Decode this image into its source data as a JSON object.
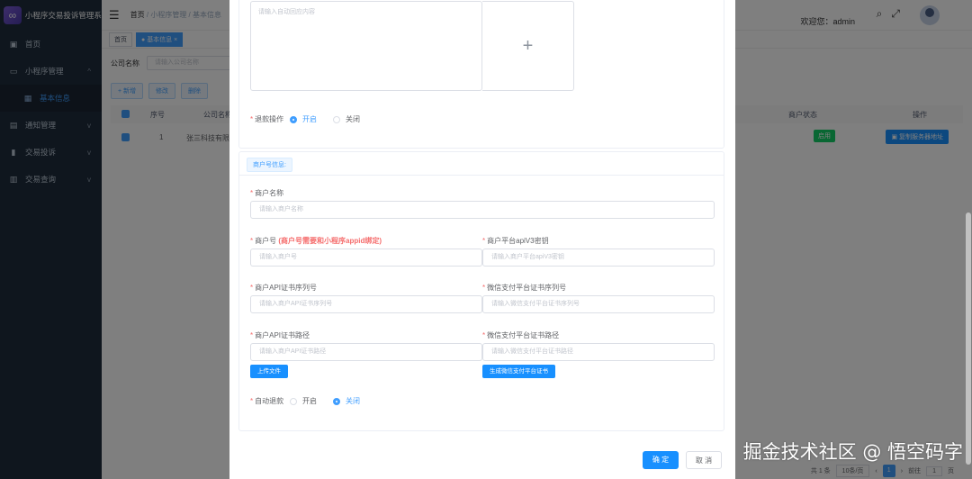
{
  "sidebar": {
    "title": "小程序交易投诉管理系统",
    "items": [
      {
        "label": "首页",
        "icon": "dashboard-icon"
      },
      {
        "label": "小程序管理",
        "icon": "app-icon"
      },
      {
        "label": "基本信息",
        "icon": "grid-icon"
      },
      {
        "label": "通知管理",
        "icon": "message-icon"
      },
      {
        "label": "交易投诉",
        "icon": "doc-icon"
      },
      {
        "label": "交易查询",
        "icon": "table-icon"
      }
    ]
  },
  "topbar": {
    "breadcrumb": [
      "首页",
      "小程序管理",
      "基本信息"
    ],
    "welcome": "欢迎您：admin"
  },
  "tags": [
    "首页",
    "基本信息"
  ],
  "search": {
    "label": "公司名称",
    "placeholder": "请输入公司名称"
  },
  "toolbar": {
    "add": "+ 新增",
    "edit": "修改",
    "delete": "删除"
  },
  "table": {
    "headers": [
      "序号",
      "公司名称",
      "商户状态",
      "操作"
    ],
    "row": {
      "index": "1",
      "company": "张三科技有限",
      "status": "启用",
      "action": "复制服务器地址"
    }
  },
  "pagination": {
    "total": "共 1 条",
    "page_size": "10条/页",
    "current": "1",
    "goto": "前往",
    "goto_page": "1",
    "page_unit": "页"
  },
  "dialog": {
    "auto_reply_placeholder": "请输入自动回应内容",
    "upload_plus": "+",
    "refund_label": "退款操作",
    "refund_on": "开启",
    "refund_off": "关闭",
    "section_title": "商户号信息:",
    "merchant_name_label": "商户名称",
    "merchant_name_placeholder": "请输入商户名称",
    "merchant_id_label": "商户号",
    "merchant_id_warning": "(商户号需要和小程序appid绑定)",
    "merchant_id_placeholder": "请输入商户号",
    "apiv3_label": "商户平台apiV3密钥",
    "apiv3_placeholder": "请输入商户平台apiV3密钥",
    "cert_serial_label": "商户API证书序列号",
    "cert_serial_placeholder": "请输入商户API证书序列号",
    "wx_cert_serial_label": "微信支付平台证书序列号",
    "wx_cert_serial_placeholder": "请输入微信支付平台证书序列号",
    "cert_path_label": "商户API证书路径",
    "cert_path_placeholder": "请输入商户API证书路径",
    "wx_cert_path_label": "微信支付平台证书路径",
    "wx_cert_path_placeholder": "请输入微信支付平台证书路径",
    "upload_button": "上传文件",
    "generate_button": "生成微信支付平台证书",
    "auto_refund_label": "自动退款",
    "auto_refund_on": "开启",
    "auto_refund_off": "关闭",
    "ok_button": "确 定",
    "cancel_button": "取 消"
  },
  "watermark": "掘金技术社区 @ 悟空码字",
  "colors": {
    "primary": "#1890ff",
    "sidebar": "#1f2d3d",
    "danger": "#f56c6c",
    "success": "#13ce66"
  }
}
